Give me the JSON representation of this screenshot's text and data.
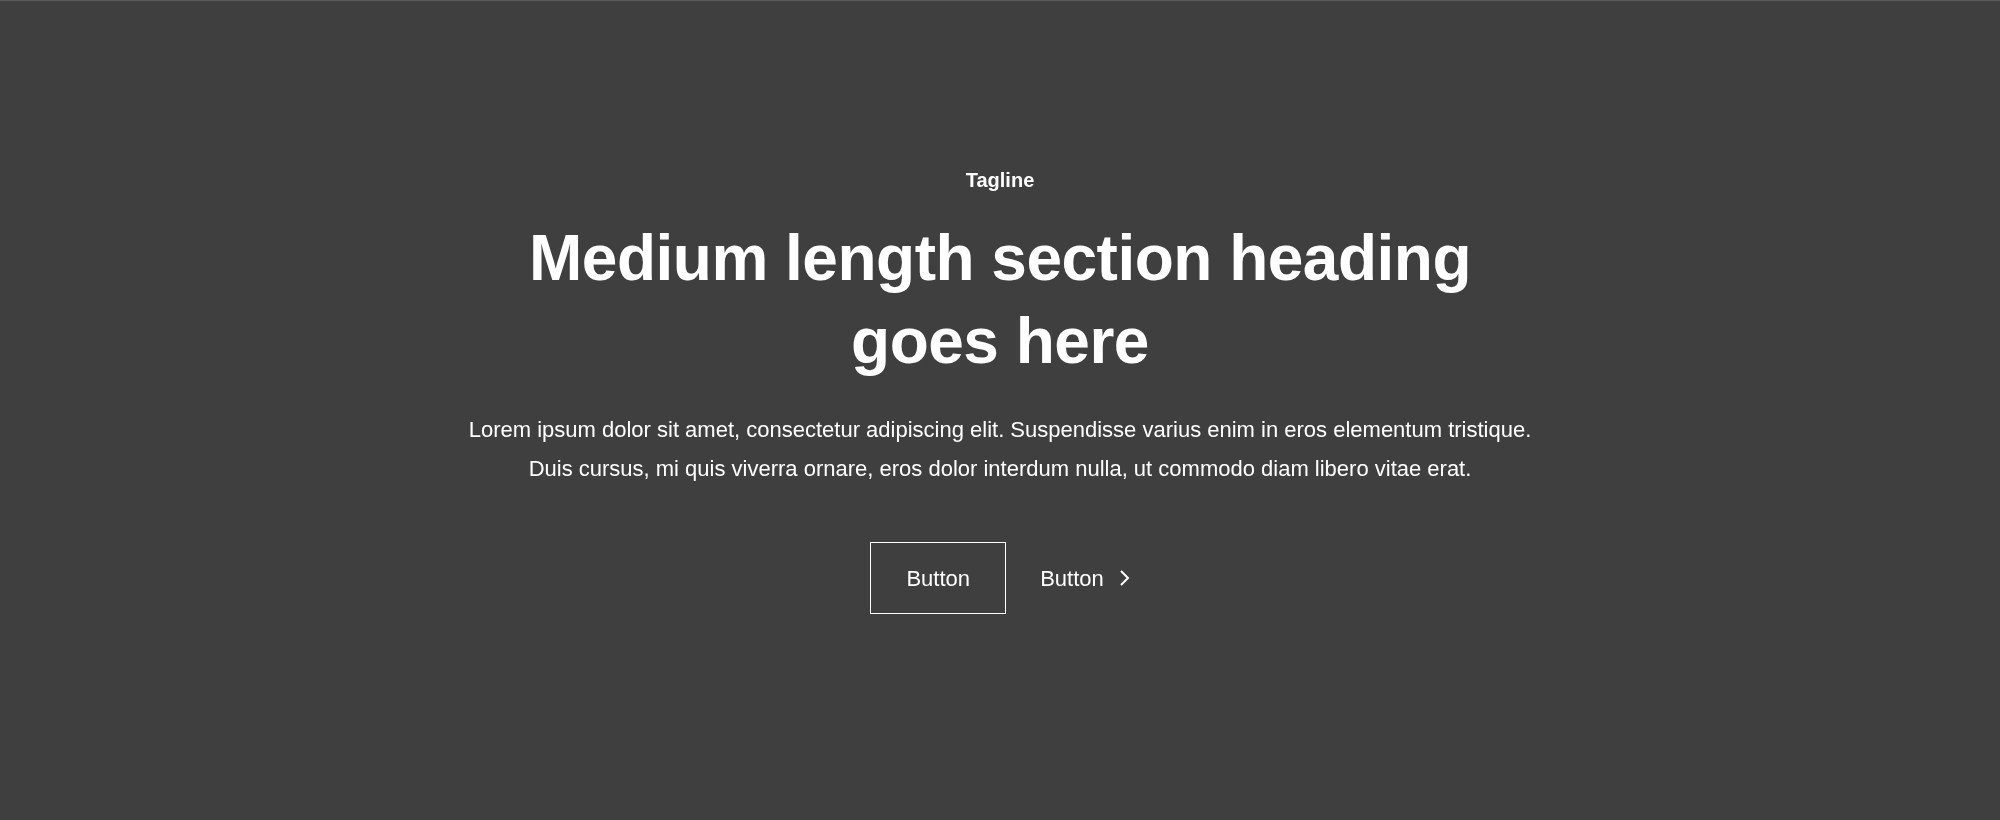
{
  "tagline": "Tagline",
  "heading": "Medium length section heading goes here",
  "description": "Lorem ipsum dolor sit amet, consectetur adipiscing elit. Suspendisse varius enim in eros elementum tristique. Duis cursus, mi quis viverra ornare, eros dolor interdum nulla, ut commodo diam libero vitae erat.",
  "buttons": [
    {
      "kind": "outline",
      "label": "Button"
    },
    {
      "kind": "link",
      "label": "Button"
    }
  ]
}
